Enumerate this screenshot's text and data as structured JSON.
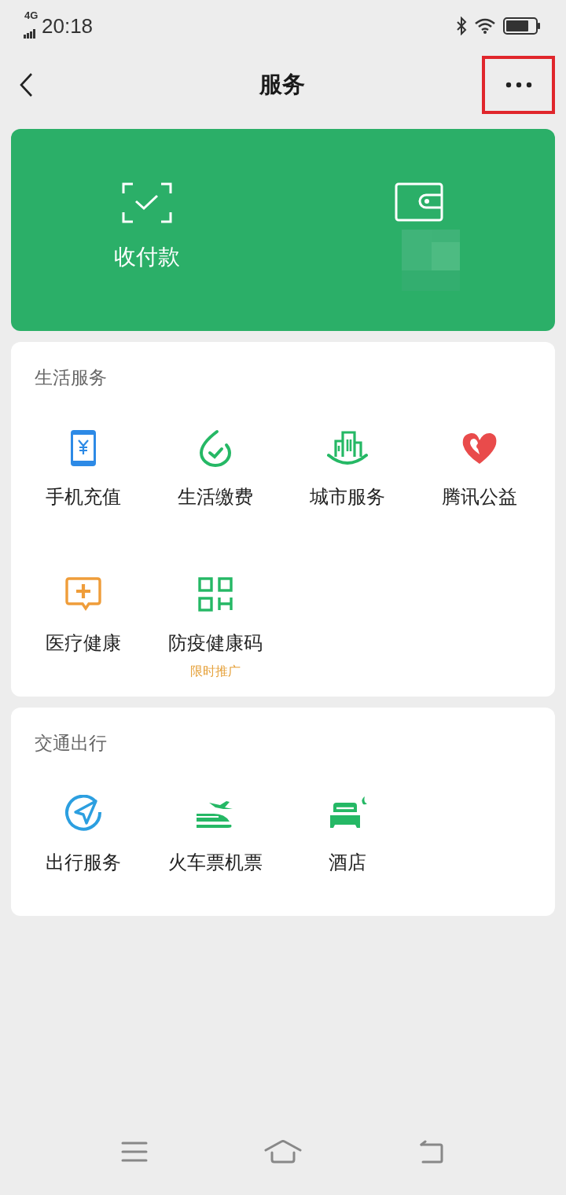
{
  "status_bar": {
    "network": "4G",
    "time": "20:18"
  },
  "nav": {
    "title": "服务",
    "more_button": {
      "highlighted": true
    }
  },
  "wallet_card": {
    "items": [
      {
        "kind": "scan",
        "label": "收付款",
        "masked": false
      },
      {
        "kind": "wallet",
        "masked": true
      }
    ]
  },
  "sections": [
    {
      "title": "生活服务",
      "items": [
        {
          "kind": "phone",
          "label": "手机充值"
        },
        {
          "kind": "drop",
          "label": "生活缴费"
        },
        {
          "kind": "city",
          "label": "城市服务"
        },
        {
          "kind": "heart",
          "label": "腾讯公益"
        },
        {
          "kind": "medical",
          "label": "医疗健康"
        },
        {
          "kind": "qr",
          "label": "防疫健康码",
          "badge": "限时推广"
        }
      ]
    },
    {
      "title": "交通出行",
      "items": [
        {
          "kind": "compass",
          "label": "出行服务"
        },
        {
          "kind": "train",
          "label": "火车票机票"
        },
        {
          "kind": "hotel",
          "label": "酒店"
        }
      ]
    }
  ]
}
